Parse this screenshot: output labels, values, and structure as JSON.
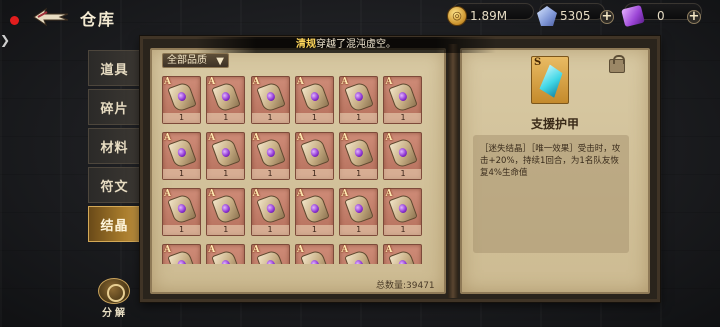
{
  "header": {
    "title": "仓库",
    "gold": "1.89M",
    "gems": "5305",
    "tickets": "0",
    "plus": "+"
  },
  "tabs": [
    {
      "label": "道具",
      "active": false
    },
    {
      "label": "碎片",
      "active": false
    },
    {
      "label": "材料",
      "active": false
    },
    {
      "label": "符文",
      "active": false
    },
    {
      "label": "结晶",
      "active": true
    }
  ],
  "notice": {
    "name": "清规",
    "text": "穿越了混沌虚空。"
  },
  "filter": {
    "selected": "全部品质"
  },
  "grid": {
    "grade": "A",
    "items": [
      {
        "count": "1"
      },
      {
        "count": "1"
      },
      {
        "count": "1"
      },
      {
        "count": "1"
      },
      {
        "count": "1"
      },
      {
        "count": "1"
      },
      {
        "count": "1"
      },
      {
        "count": "1"
      },
      {
        "count": "1"
      },
      {
        "count": "1"
      },
      {
        "count": "1"
      },
      {
        "count": "1"
      },
      {
        "count": "1"
      },
      {
        "count": "1"
      },
      {
        "count": "1"
      },
      {
        "count": "1"
      },
      {
        "count": "1"
      },
      {
        "count": "1"
      },
      {
        "count": ""
      },
      {
        "count": ""
      },
      {
        "count": ""
      },
      {
        "count": ""
      },
      {
        "count": ""
      },
      {
        "count": ""
      }
    ]
  },
  "total": "总数量:39471",
  "detail": {
    "grade": "S",
    "name": "支援护甲",
    "description": "［迷失结晶］［唯一效果］受击时，攻击+20%，持续1回合，为1名队友恢复4%生命值"
  },
  "actions": {
    "disassemble": "分解"
  }
}
